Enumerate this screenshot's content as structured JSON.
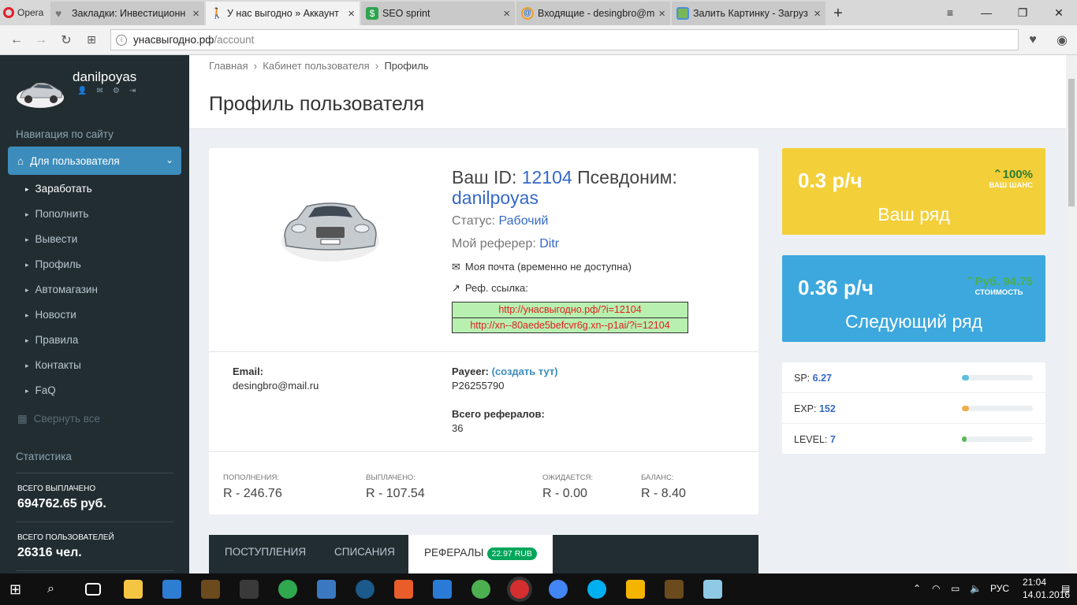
{
  "browser": {
    "name": "Opera",
    "tabs": [
      {
        "title": "Закладки: Инвестиционн",
        "favicon": "heart-icon",
        "color": "#888888"
      },
      {
        "title": "У нас выгодно » Аккаунт",
        "favicon": "walker-icon",
        "color": "#555555"
      },
      {
        "title": "SEO sprint",
        "favicon": "dollar-icon",
        "color": "#2ea44f"
      },
      {
        "title": "Входящие - desingbro@m",
        "favicon": "mail-icon",
        "color": "#f0a020"
      },
      {
        "title": "Залить Картинку - Загруз",
        "favicon": "picture-icon",
        "color": "#4a90d9"
      }
    ],
    "url_host": "унасвыгодно.рф",
    "url_path": "/account"
  },
  "sidebar": {
    "username": "danilpoyas",
    "nav_title": "Навигация по сайту",
    "main_item": "Для пользователя",
    "items": [
      "Заработать",
      "Пополнить",
      "Вывести",
      "Профиль",
      "Автомагазин",
      "Новости",
      "Правила",
      "Контакты",
      "FaQ"
    ],
    "collapse": "Свернуть все",
    "stats_title": "Статистика",
    "total_paid_label": "всего выплачено",
    "total_paid": "694762.65 руб.",
    "total_users_label": "всего пользователей",
    "total_users": "26316 чел."
  },
  "breadcrumb": {
    "home": "Главная",
    "cabinet": "Кабинет пользователя",
    "current": "Профиль"
  },
  "page_title": "Профиль пользователя",
  "profile": {
    "id_label": "Ваш ID:",
    "id": "12104",
    "alias_label": "Псевдоним:",
    "alias": "danilpoyas",
    "status_label": "Статус:",
    "status": "Рабочий",
    "referrer_label": "Мой реферер:",
    "referrer": "Ditr",
    "mail_text": "Моя почта (временно не доступна)",
    "ref_label": "Реф. ссылка:",
    "ref_link1": "http://унасвыгодно.рф/?i=12104",
    "ref_link2": "http://xn--80aede5befcvr6g.xn--p1ai/?i=12104",
    "email_label": "Email:",
    "email": "desingbro@mail.ru",
    "payeer_label": "Payeer:",
    "payeer_link": "(создать тут)",
    "payeer": "P26255790",
    "refs_label": "Всего рефералов:",
    "refs": "36",
    "deposits_label": "пополнения:",
    "deposits": "R - 246.76",
    "paid_label": "выплачено:",
    "paid": "R - 107.54",
    "expected_label": "ожидается:",
    "expected": "R - 0.00",
    "balance_label": "баланс:",
    "balance": "R - 8.40"
  },
  "boxes": {
    "current": {
      "rate": "0.3 р/ч",
      "title": "Ваш ряд",
      "pct": "100%",
      "pct_label": "ваш шанс",
      "color": "#f3cf3a"
    },
    "next": {
      "rate": "0.36 р/ч",
      "title": "Следующий ряд",
      "pct": "Руб. 94.75",
      "pct_label": "стоимость",
      "color": "#3ca8dd"
    }
  },
  "stats": [
    {
      "label": "SP:",
      "value": "6.27",
      "fill": 0.1,
      "color": "#5bc0de"
    },
    {
      "label": "EXP:",
      "value": "152",
      "fill": 0.1,
      "color": "#f0ad4e"
    },
    {
      "label": "LEVEL:",
      "value": "7",
      "fill": 0.07,
      "color": "#5cb85c"
    }
  ],
  "tabs": {
    "income": "ПОСТУПЛЕНИЯ",
    "writeoffs": "СПИСАНИЯ",
    "referrals": "РЕФЕРАЛЫ",
    "referrals_badge": "22.97 RUB"
  },
  "taskbar": {
    "lang": "РУС",
    "time": "21:04",
    "date": "14.01.2016"
  }
}
